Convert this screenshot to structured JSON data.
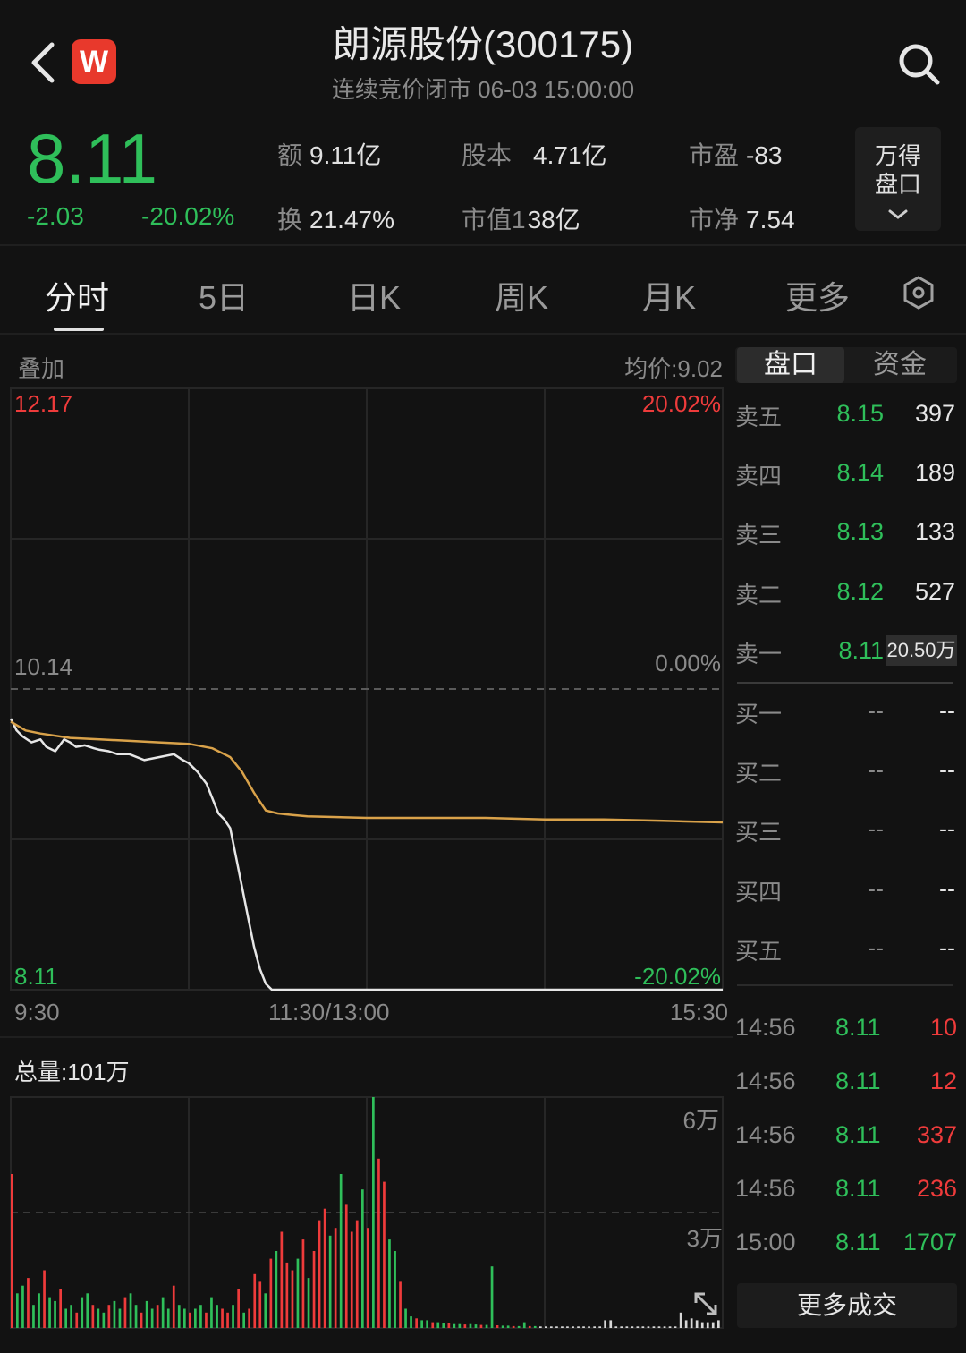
{
  "header": {
    "title": "朗源股份(300175)",
    "subtitle": "连续竞价闭市  06-03 15:00:00",
    "app_badge": "W"
  },
  "quote": {
    "price": "8.11",
    "change": "-2.03",
    "change_pct": "-20.02%",
    "stats": [
      {
        "key": "额",
        "value": "9.11亿"
      },
      {
        "key": "股本",
        "value": "4.71亿"
      },
      {
        "key": "市盈",
        "value": "-83"
      },
      {
        "key": "换",
        "value": "21.47%"
      },
      {
        "key": "市值1",
        "value": "38亿"
      },
      {
        "key": "市净",
        "value": "7.54"
      }
    ],
    "pankou_button": {
      "line1": "万得",
      "line2": "盘口"
    }
  },
  "tabs": [
    "分时",
    "5日",
    "日K",
    "周K",
    "月K",
    "更多"
  ],
  "chart": {
    "overlay_label": "叠加",
    "avg_price_label": "均价:9.02",
    "price_high": "12.17",
    "price_mid": "10.14",
    "price_low": "8.11",
    "pct_high": "20.02%",
    "pct_mid": "0.00%",
    "pct_low": "-20.02%",
    "time_labels": [
      "9:30",
      "11:30/13:00",
      "15:30"
    ],
    "volume_label": "总量:101万",
    "volume_high": "6万",
    "volume_mid": "3万"
  },
  "chart_data": {
    "type": "line",
    "title": "",
    "xlabel": "",
    "ylabel": "",
    "x_range": [
      0,
      240
    ],
    "ylim": [
      8.11,
      12.17
    ],
    "prev_close": 10.14,
    "series": [
      {
        "name": "",
        "color": "#e6e6e6",
        "x": [
          0,
          2,
          4,
          7,
          10,
          12,
          15,
          18,
          20,
          22,
          25,
          28,
          30,
          33,
          36,
          40,
          45,
          50,
          55,
          58,
          60,
          63,
          66,
          70,
          72,
          74,
          76,
          78,
          80,
          82,
          84,
          86,
          88,
          90,
          92,
          94,
          96,
          98,
          100,
          110,
          120,
          140,
          160,
          180,
          200,
          220,
          240
        ],
        "y": [
          9.94,
          9.86,
          9.82,
          9.78,
          9.8,
          9.75,
          9.72,
          9.8,
          9.78,
          9.75,
          9.76,
          9.74,
          9.73,
          9.72,
          9.7,
          9.7,
          9.66,
          9.68,
          9.7,
          9.66,
          9.64,
          9.58,
          9.5,
          9.3,
          9.26,
          9.2,
          9.0,
          8.8,
          8.6,
          8.4,
          8.25,
          8.15,
          8.11,
          8.11,
          8.11,
          8.11,
          8.11,
          8.11,
          8.11,
          8.11,
          8.11,
          8.11,
          8.11,
          8.11,
          8.11,
          8.11,
          8.11
        ]
      },
      {
        "name": "",
        "color": "#d9a24a",
        "x": [
          0,
          5,
          10,
          20,
          30,
          40,
          50,
          60,
          68,
          74,
          78,
          82,
          86,
          90,
          95,
          100,
          120,
          140,
          160,
          180,
          200,
          220,
          240
        ],
        "y": [
          9.92,
          9.86,
          9.84,
          9.81,
          9.8,
          9.79,
          9.78,
          9.77,
          9.74,
          9.68,
          9.58,
          9.44,
          9.32,
          9.3,
          9.29,
          9.28,
          9.27,
          9.27,
          9.27,
          9.26,
          9.26,
          9.25,
          9.24
        ]
      }
    ],
    "volume": {
      "ylim": [
        0,
        60000
      ],
      "values": [
        40000,
        9000,
        11000,
        13000,
        6000,
        9000,
        15000,
        8000,
        7000,
        10000,
        5000,
        6000,
        4000,
        8000,
        9000,
        6000,
        5000,
        4000,
        6000,
        7000,
        5000,
        8000,
        9000,
        6000,
        4000,
        7000,
        5000,
        6000,
        8000,
        5000,
        11000,
        6000,
        5000,
        4000,
        5000,
        6000,
        4000,
        8000,
        6000,
        5000,
        4000,
        6000,
        10000,
        4000,
        5000,
        14000,
        12000,
        9000,
        18000,
        20000,
        25000,
        17000,
        15000,
        18000,
        23000,
        13000,
        20000,
        28000,
        31000,
        24000,
        26000,
        40000,
        32000,
        25000,
        28000,
        36000,
        26000,
        60000,
        44000,
        38000,
        23000,
        20000,
        12000,
        5000,
        3000,
        2500,
        2000,
        2000,
        1500,
        1500,
        1200,
        1200,
        1000,
        1000,
        900,
        1000,
        900,
        800,
        800,
        16000,
        700,
        600,
        600,
        500,
        500,
        1500,
        500,
        500,
        400,
        400,
        400,
        400,
        400,
        400,
        400,
        400,
        400,
        400,
        400,
        400,
        2000,
        2000,
        400,
        400,
        400,
        400,
        400,
        400,
        400,
        400,
        400,
        400,
        400,
        400,
        4000,
        2000,
        2500,
        2000,
        1500,
        1500,
        1500,
        2000
      ]
    }
  },
  "order_book": {
    "tabs": [
      "盘口",
      "资金"
    ],
    "asks": [
      {
        "label": "卖五",
        "price": "8.15",
        "volume": "397"
      },
      {
        "label": "卖四",
        "price": "8.14",
        "volume": "189"
      },
      {
        "label": "卖三",
        "price": "8.13",
        "volume": "133"
      },
      {
        "label": "卖二",
        "price": "8.12",
        "volume": "527"
      },
      {
        "label": "卖一",
        "price": "8.11",
        "volume": "20.50万"
      }
    ],
    "bids": [
      {
        "label": "买一",
        "price": "--",
        "volume": "--"
      },
      {
        "label": "买二",
        "price": "--",
        "volume": "--"
      },
      {
        "label": "买三",
        "price": "--",
        "volume": "--"
      },
      {
        "label": "买四",
        "price": "--",
        "volume": "--"
      },
      {
        "label": "买五",
        "price": "--",
        "volume": "--"
      }
    ],
    "trades": [
      {
        "time": "14:56",
        "price": "8.11",
        "volume": "10",
        "color": "#ee3b3b"
      },
      {
        "time": "14:56",
        "price": "8.11",
        "volume": "12",
        "color": "#ee3b3b"
      },
      {
        "time": "14:56",
        "price": "8.11",
        "volume": "337",
        "color": "#ee3b3b"
      },
      {
        "time": "14:56",
        "price": "8.11",
        "volume": "236",
        "color": "#ee3b3b"
      },
      {
        "time": "15:00",
        "price": "8.11",
        "volume": "1707",
        "color": "#2fbf5a"
      }
    ],
    "more_trades_label": "更多成交"
  },
  "colors": {
    "up": "#ee3b3b",
    "down": "#2fbf5a",
    "avg_line": "#d9a24a",
    "price_line": "#e6e6e6"
  }
}
